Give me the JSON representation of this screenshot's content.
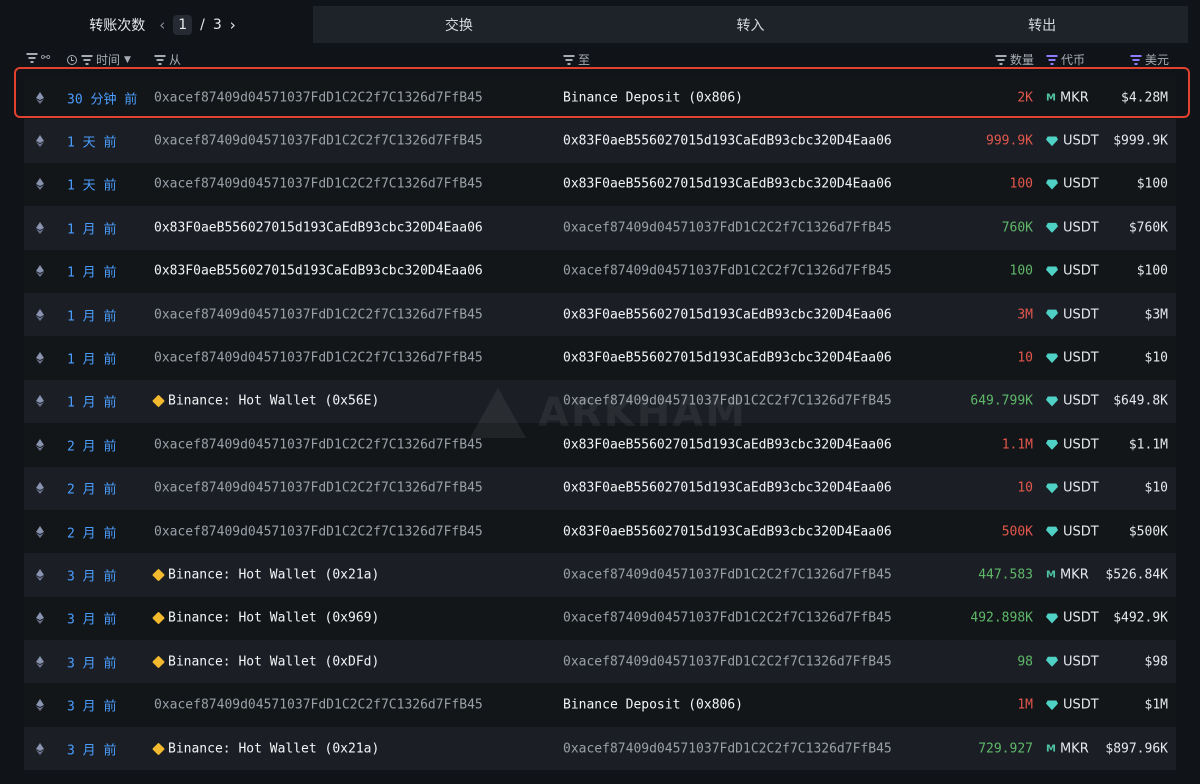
{
  "tabs": {
    "transfers_label": "转账次数",
    "page_current": "1",
    "page_sep": "/",
    "page_total": "3",
    "swap": "交换",
    "in": "转入",
    "out": "转出"
  },
  "header": {
    "time": "时间",
    "from": "从",
    "to": "至",
    "amount": "数量",
    "token": "代币",
    "usd": "美元"
  },
  "watermark": "ARKHAM",
  "rows": [
    {
      "time": "30 分钟 前",
      "from": "0xacef87409d04571037FdD1C2C2f7C1326d7FfB45",
      "from_entity": false,
      "to": "Binance Deposit (0x806)",
      "to_entity": false,
      "amount": "2K",
      "amount_color": "red",
      "token": "MKR",
      "token_icon": "mkr-icon",
      "usd": "$4.28M",
      "from_bright": false,
      "to_bright": true
    },
    {
      "time": "1 天 前",
      "from": "0xacef87409d04571037FdD1C2C2f7C1326d7FfB45",
      "from_entity": false,
      "to": "0x83F0aeB556027015d193CaEdB93cbc320D4Eaa06",
      "amount": "999.9K",
      "amount_color": "red",
      "token": "USDT",
      "token_icon": "usdt-icon",
      "usd": "$999.9K",
      "from_bright": false,
      "to_bright": true
    },
    {
      "time": "1 天 前",
      "from": "0xacef87409d04571037FdD1C2C2f7C1326d7FfB45",
      "from_entity": false,
      "to": "0x83F0aeB556027015d193CaEdB93cbc320D4Eaa06",
      "amount": "100",
      "amount_color": "red",
      "token": "USDT",
      "token_icon": "usdt-icon",
      "usd": "$100",
      "from_bright": false,
      "to_bright": true
    },
    {
      "time": "1 月 前",
      "from": "0x83F0aeB556027015d193CaEdB93cbc320D4Eaa06",
      "from_entity": false,
      "to": "0xacef87409d04571037FdD1C2C2f7C1326d7FfB45",
      "amount": "760K",
      "amount_color": "green",
      "token": "USDT",
      "token_icon": "usdt-icon",
      "usd": "$760K",
      "from_bright": true,
      "to_bright": false
    },
    {
      "time": "1 月 前",
      "from": "0x83F0aeB556027015d193CaEdB93cbc320D4Eaa06",
      "from_entity": false,
      "to": "0xacef87409d04571037FdD1C2C2f7C1326d7FfB45",
      "amount": "100",
      "amount_color": "green",
      "token": "USDT",
      "token_icon": "usdt-icon",
      "usd": "$100",
      "from_bright": true,
      "to_bright": false
    },
    {
      "time": "1 月 前",
      "from": "0xacef87409d04571037FdD1C2C2f7C1326d7FfB45",
      "from_entity": false,
      "to": "0x83F0aeB556027015d193CaEdB93cbc320D4Eaa06",
      "amount": "3M",
      "amount_color": "red",
      "token": "USDT",
      "token_icon": "usdt-icon",
      "usd": "$3M",
      "from_bright": false,
      "to_bright": true
    },
    {
      "time": "1 月 前",
      "from": "0xacef87409d04571037FdD1C2C2f7C1326d7FfB45",
      "from_entity": false,
      "to": "0x83F0aeB556027015d193CaEdB93cbc320D4Eaa06",
      "amount": "10",
      "amount_color": "red",
      "token": "USDT",
      "token_icon": "usdt-icon",
      "usd": "$10",
      "from_bright": false,
      "to_bright": true
    },
    {
      "time": "1 月 前",
      "from": "Binance: Hot Wallet (0x56E)",
      "from_entity": true,
      "to": "0xacef87409d04571037FdD1C2C2f7C1326d7FfB45",
      "amount": "649.799K",
      "amount_color": "green",
      "token": "USDT",
      "token_icon": "usdt-icon",
      "usd": "$649.8K",
      "from_bright": true,
      "to_bright": false
    },
    {
      "time": "2 月 前",
      "from": "0xacef87409d04571037FdD1C2C2f7C1326d7FfB45",
      "from_entity": false,
      "to": "0x83F0aeB556027015d193CaEdB93cbc320D4Eaa06",
      "amount": "1.1M",
      "amount_color": "red",
      "token": "USDT",
      "token_icon": "usdt-icon",
      "usd": "$1.1M",
      "from_bright": false,
      "to_bright": true
    },
    {
      "time": "2 月 前",
      "from": "0xacef87409d04571037FdD1C2C2f7C1326d7FfB45",
      "from_entity": false,
      "to": "0x83F0aeB556027015d193CaEdB93cbc320D4Eaa06",
      "amount": "10",
      "amount_color": "red",
      "token": "USDT",
      "token_icon": "usdt-icon",
      "usd": "$10",
      "from_bright": false,
      "to_bright": true
    },
    {
      "time": "2 月 前",
      "from": "0xacef87409d04571037FdD1C2C2f7C1326d7FfB45",
      "from_entity": false,
      "to": "0x83F0aeB556027015d193CaEdB93cbc320D4Eaa06",
      "amount": "500K",
      "amount_color": "red",
      "token": "USDT",
      "token_icon": "usdt-icon",
      "usd": "$500K",
      "from_bright": false,
      "to_bright": true
    },
    {
      "time": "3 月 前",
      "from": "Binance: Hot Wallet (0x21a)",
      "from_entity": true,
      "to": "0xacef87409d04571037FdD1C2C2f7C1326d7FfB45",
      "amount": "447.583",
      "amount_color": "green",
      "token": "MKR",
      "token_icon": "mkr-icon",
      "usd": "$526.84K",
      "from_bright": true,
      "to_bright": false
    },
    {
      "time": "3 月 前",
      "from": "Binance: Hot Wallet (0x969)",
      "from_entity": true,
      "to": "0xacef87409d04571037FdD1C2C2f7C1326d7FfB45",
      "amount": "492.898K",
      "amount_color": "green",
      "token": "USDT",
      "token_icon": "usdt-icon",
      "usd": "$492.9K",
      "from_bright": true,
      "to_bright": false
    },
    {
      "time": "3 月 前",
      "from": "Binance: Hot Wallet (0xDFd)",
      "from_entity": true,
      "to": "0xacef87409d04571037FdD1C2C2f7C1326d7FfB45",
      "amount": "98",
      "amount_color": "green",
      "token": "USDT",
      "token_icon": "usdt-icon",
      "usd": "$98",
      "from_bright": true,
      "to_bright": false
    },
    {
      "time": "3 月 前",
      "from": "0xacef87409d04571037FdD1C2C2f7C1326d7FfB45",
      "from_entity": false,
      "to": "Binance Deposit (0x806)",
      "amount": "1M",
      "amount_color": "red",
      "token": "USDT",
      "token_icon": "usdt-icon",
      "usd": "$1M",
      "from_bright": false,
      "to_bright": true
    },
    {
      "time": "3 月 前",
      "from": "Binance: Hot Wallet (0x21a)",
      "from_entity": true,
      "to": "0xacef87409d04571037FdD1C2C2f7C1326d7FfB45",
      "amount": "729.927",
      "amount_color": "green",
      "token": "MKR",
      "token_icon": "mkr-icon",
      "usd": "$897.96K",
      "from_bright": true,
      "to_bright": false
    }
  ]
}
